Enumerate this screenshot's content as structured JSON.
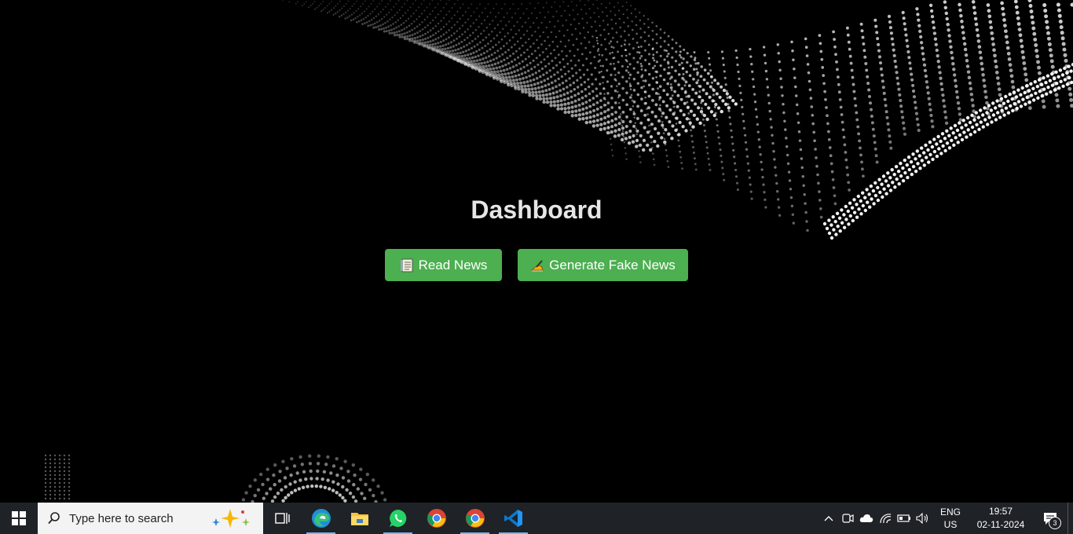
{
  "main": {
    "title": "Dashboard",
    "buttons": {
      "read_news": {
        "icon": "notebook-icon",
        "label": "Read News"
      },
      "generate_fake_news": {
        "icon": "writing-hand-icon",
        "label": "Generate Fake News"
      }
    },
    "accent_color": "#4caf50"
  },
  "taskbar": {
    "search_placeholder": "Type here to search",
    "pinned_apps": [
      "task-view",
      "edge",
      "file-explorer",
      "whatsapp",
      "chrome",
      "chrome",
      "vscode"
    ],
    "tray": {
      "language_top": "ENG",
      "language_bottom": "US",
      "time": "19:57",
      "date": "02-11-2024",
      "notification_count": "3"
    }
  }
}
